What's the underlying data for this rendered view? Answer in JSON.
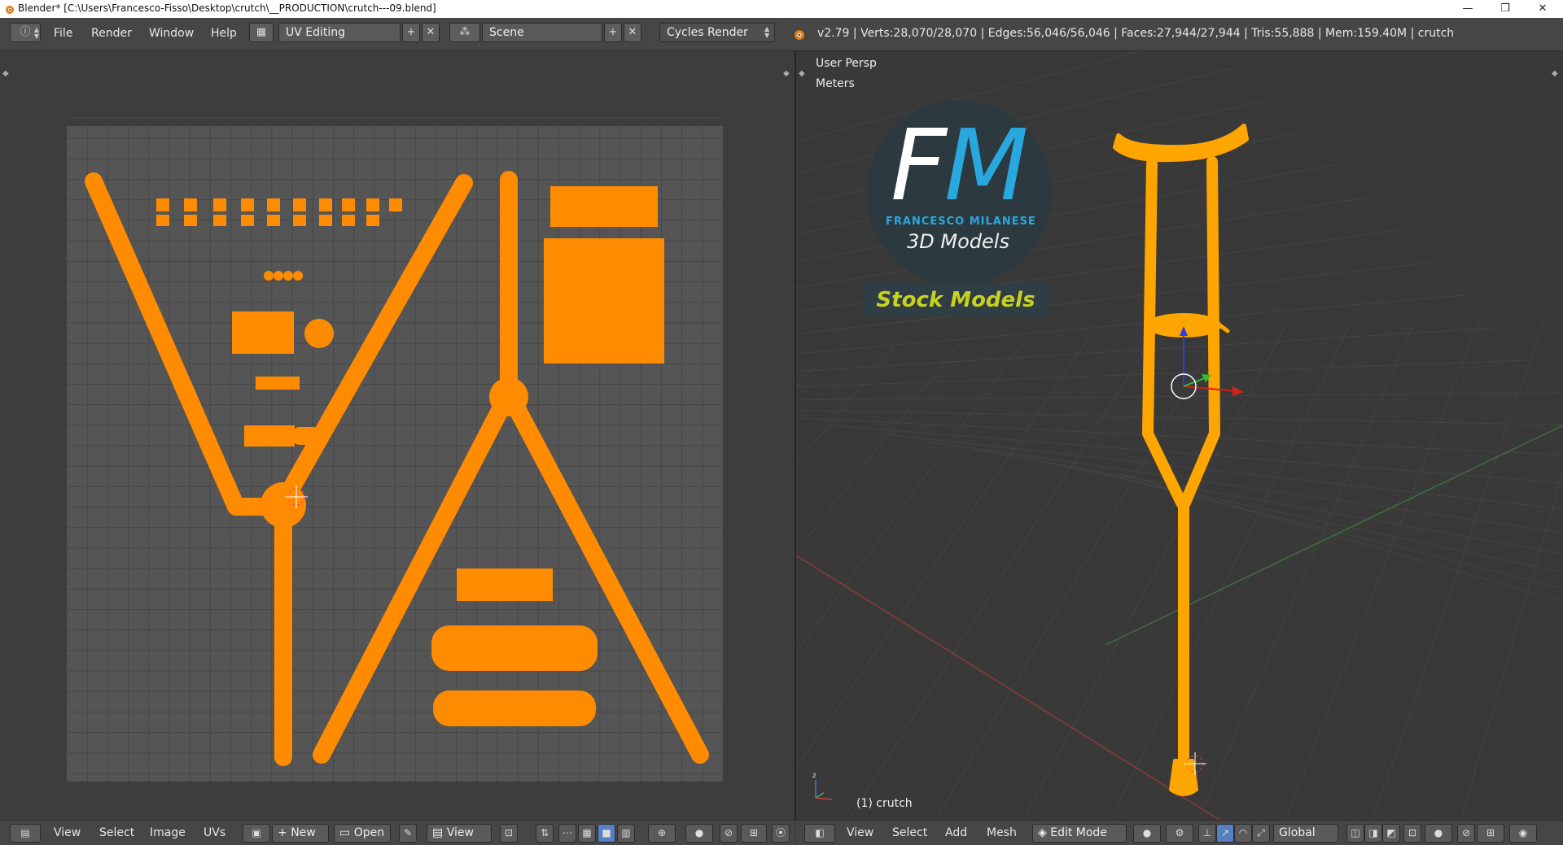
{
  "window": {
    "title": "Blender* [C:\\Users\\Francesco-Fisso\\Desktop\\crutch\\__PRODUCTION\\crutch---09.blend]",
    "minimize": "—",
    "restore": "❐",
    "close": "✕"
  },
  "topbar": {
    "menus": [
      "File",
      "Render",
      "Window",
      "Help"
    ],
    "screen_layout": "UV Editing",
    "scene": "Scene",
    "render_engine": "Cycles Render",
    "stats": "v2.79 | Verts:28,070/28,070 | Edges:56,046/56,046 | Faces:27,944/27,944 | Tris:55,888 | Mem:159.40M | crutch"
  },
  "viewport": {
    "view_name": "User Persp",
    "units": "Meters",
    "object_label": "(1) crutch",
    "logo": {
      "f": "F",
      "m": "M",
      "name": "FRANCESCO MILANESE",
      "sub": "3D Models",
      "stock": "Stock Models"
    }
  },
  "uv_bottombar": {
    "menus": [
      "View",
      "Select",
      "Image",
      "UVs"
    ],
    "new_label": "New",
    "open_label": "Open",
    "view_label": "View"
  },
  "vp_bottombar": {
    "menus": [
      "View",
      "Select",
      "Add",
      "Mesh"
    ],
    "mode": "Edit Mode",
    "orientation": "Global"
  },
  "colors": {
    "uv_island": "#ff8c00",
    "mesh": "#ffa500",
    "grid_dark": "#3d3d3d",
    "uv_bg": "#555555",
    "accent_blue": "#29a8e0",
    "stock_yellow": "#c8d21e"
  }
}
